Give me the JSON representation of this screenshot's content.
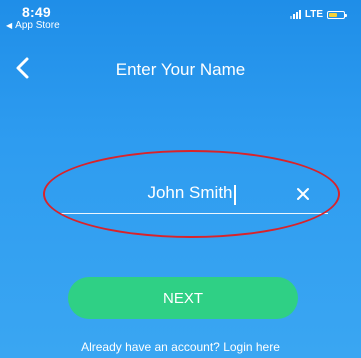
{
  "status_bar": {
    "time": "8:49",
    "back_app": "App Store",
    "network": "LTE",
    "battery_level": 0.55
  },
  "header": {
    "title": "Enter Your Name"
  },
  "name_field": {
    "value": "John Smith",
    "placeholder": ""
  },
  "next_button": {
    "label": "NEXT"
  },
  "login": {
    "text": "Already have an account? Login here"
  },
  "colors": {
    "background_top": "#1f8ee8",
    "background_bottom": "#3aa6f2",
    "button": "#2fd085",
    "annotation": "#d9232a",
    "battery": "#f4d23a"
  },
  "icons": {
    "back": "chevron-left-icon",
    "clear": "close-icon",
    "signal": "signal-icon",
    "battery": "battery-icon"
  }
}
